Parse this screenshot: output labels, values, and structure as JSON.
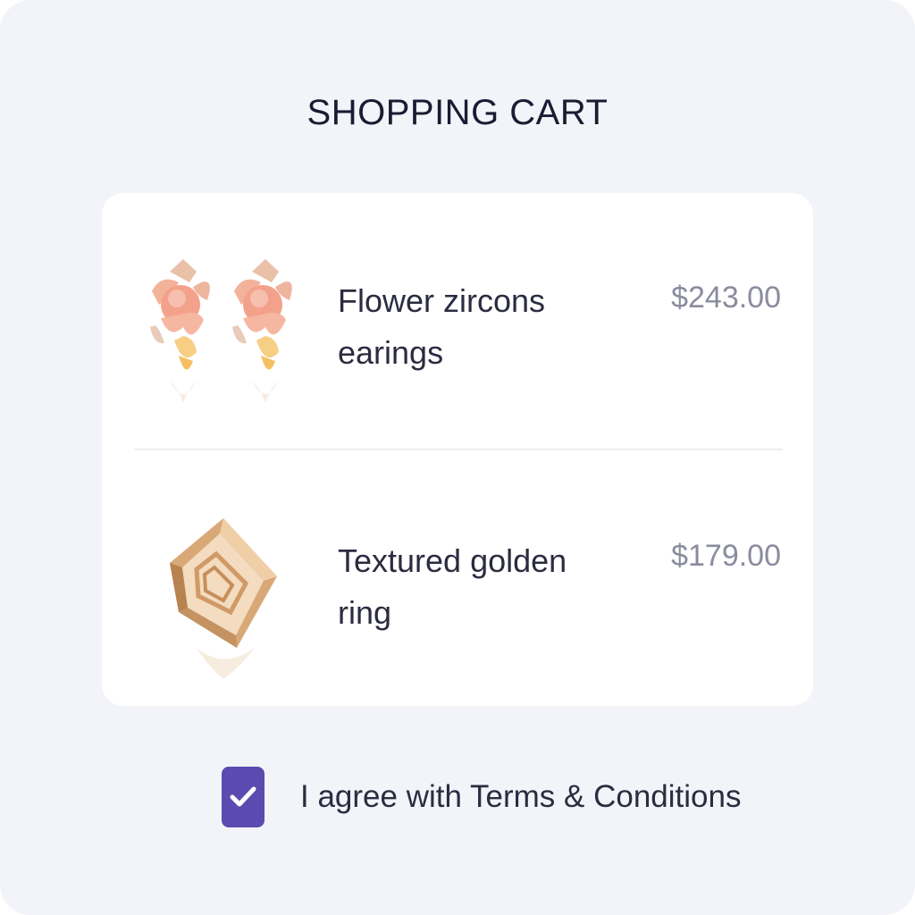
{
  "header": {
    "title": "SHOPPING CART"
  },
  "cart": {
    "items": [
      {
        "name": "Flower zircons earings",
        "price": "$243.00",
        "image_icon": "flower-earrings-image"
      },
      {
        "name": "Textured golden ring",
        "price": "$179.00",
        "image_icon": "golden-ring-image"
      }
    ]
  },
  "terms": {
    "checked": true,
    "label": "I agree with Terms & Conditions"
  },
  "colors": {
    "background": "#f3f4f9",
    "card": "#ffffff",
    "accent": "#5b4bb0",
    "title_text": "#1b1c33",
    "price_text": "#8a8c9e"
  }
}
